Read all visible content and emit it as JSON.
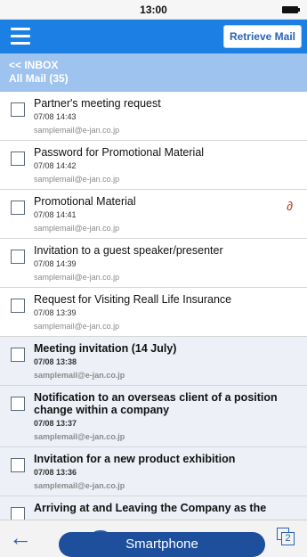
{
  "status_bar": {
    "time": "13:00"
  },
  "header": {
    "retrieve_label": "Retrieve Mail"
  },
  "folder": {
    "back_label": "<< INBOX",
    "title": "All Mail (35)"
  },
  "mails": [
    {
      "subject": "Partner's meeting request",
      "date": "07/08 14:43",
      "sender": "samplemail@e-jan.co.jp",
      "unread": false,
      "attachment": false
    },
    {
      "subject": "Password for Promotional Material",
      "date": "07/08 14:42",
      "sender": "samplemail@e-jan.co.jp",
      "unread": false,
      "attachment": false
    },
    {
      "subject": "Promotional Material",
      "date": "07/08 14:41",
      "sender": "samplemail@e-jan.co.jp",
      "unread": false,
      "attachment": true
    },
    {
      "subject": "Invitation to a guest speaker/presenter",
      "date": "07/08 14:39",
      "sender": "samplemail@e-jan.co.jp",
      "unread": false,
      "attachment": false
    },
    {
      "subject": "Request for Visiting Reall Life Insurance",
      "date": "07/08 13:39",
      "sender": "samplemail@e-jan.co.jp",
      "unread": false,
      "attachment": false
    },
    {
      "subject": "Meeting invitation (14 July)",
      "date": "07/08 13:38",
      "sender": "samplemail@e-jan.co.jp",
      "unread": true,
      "attachment": false
    },
    {
      "subject": "Notification to an overseas client of a position change within a company",
      "date": "07/08 13:37",
      "sender": "samplemail@e-jan.co.jp",
      "unread": true,
      "attachment": false
    },
    {
      "subject": "Invitation for a new product exhibition",
      "date": "07/08 13:36",
      "sender": "samplemail@e-jan.co.jp",
      "unread": true,
      "attachment": false
    },
    {
      "subject": "Arriving at and Leaving the Company as the",
      "date": "",
      "sender": "",
      "unread": true,
      "attachment": false
    }
  ],
  "toolbar": {
    "back_icon": "arrow-left-icon",
    "pages_count": "2"
  },
  "device_label": "Smartphone",
  "colors": {
    "header": "#1c7fe3",
    "folder_bar": "#9ec3ee",
    "label_pill": "#1d4f9c",
    "unread_bg": "#edf1f7"
  }
}
